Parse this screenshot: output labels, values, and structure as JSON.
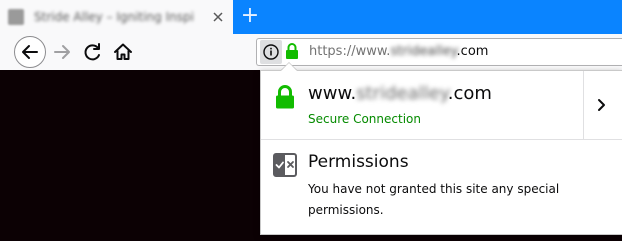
{
  "tab": {
    "title": "Stride Alley – Igniting Inspirati…",
    "favicon": "site-favicon",
    "close_icon": "close-icon"
  },
  "new_tab": {
    "label": "+"
  },
  "toolbar": {
    "back_icon": "back-arrow-icon",
    "forward_icon": "forward-arrow-icon",
    "reload_icon": "reload-icon",
    "home_icon": "home-icon"
  },
  "urlbar": {
    "info_icon": "info-icon",
    "lock_icon": "lock-icon",
    "prefix": "https://www.",
    "domain_blurred": "stridealley",
    "suffix": ".com"
  },
  "panel": {
    "connection": {
      "host_prefix": "www.",
      "host_blurred": "stridealley",
      "host_suffix": ".com",
      "status": "Secure Connection",
      "status_color": "#058b00",
      "more_icon": "chevron-right-icon"
    },
    "permissions": {
      "icon": "permissions-icon",
      "title": "Permissions",
      "description": "You have not granted this site any special permissions."
    }
  },
  "colors": {
    "accent": "#0a84ff",
    "lock_green": "#12bc00",
    "page_background": "#0c0104"
  }
}
